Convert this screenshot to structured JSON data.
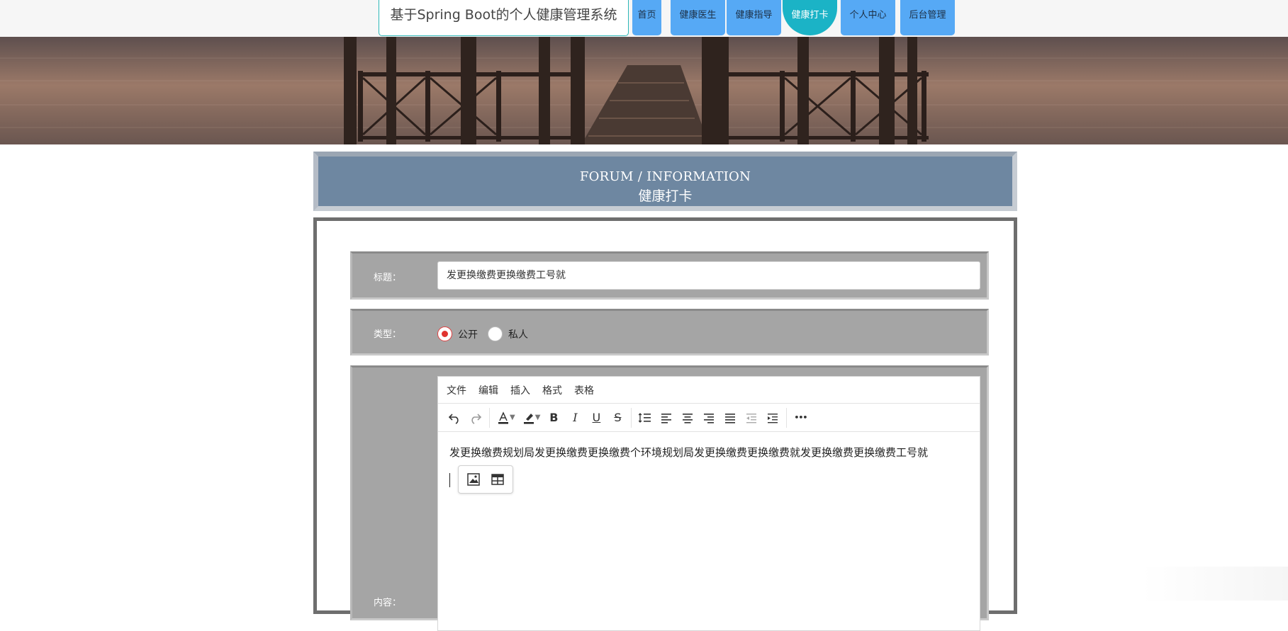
{
  "site": {
    "title": "基于Spring Boot的个人健康管理系统",
    "accent_color": "#56a9f5",
    "active_color": "#1bb3c6"
  },
  "nav": {
    "items": [
      {
        "label": "首页"
      },
      {
        "label": "健康医生"
      },
      {
        "label": "健康指导"
      },
      {
        "label": "健康打卡",
        "active": true
      },
      {
        "label": "个人中心"
      },
      {
        "label": "后台管理"
      }
    ]
  },
  "section": {
    "title_en": "FORUM / INFORMATION",
    "title_zh": "健康打卡"
  },
  "form": {
    "title_label": "标题：",
    "title_value": "发更换缴费更换缴费工号就",
    "type_label": "类型：",
    "type_options": [
      {
        "label": "公开",
        "checked": true
      },
      {
        "label": "私人",
        "checked": false
      }
    ],
    "content_label": "内容：",
    "editor": {
      "menu": [
        "文件",
        "编辑",
        "插入",
        "格式",
        "表格"
      ],
      "toolbar_icons": [
        "undo-icon",
        "redo-icon",
        "font-color-icon",
        "highlight-color-icon",
        "bold-icon",
        "italic-icon",
        "underline-icon",
        "strikethrough-icon",
        "line-height-icon",
        "align-left-icon",
        "align-center-icon",
        "align-right-icon",
        "align-justify-icon",
        "outdent-icon",
        "indent-icon",
        "more-icon"
      ],
      "toolbar_glyphs": {
        "bold": "B",
        "italic": "I",
        "underline": "U",
        "strikethrough": "S",
        "more": "•••"
      },
      "body_text": "发更换缴费规划局发更换缴费更换缴费个环境规划局发更换缴费更换缴费就发更换缴费更换缴费工号就",
      "quick_insert_icons": [
        "image-icon",
        "table-icon"
      ]
    }
  }
}
